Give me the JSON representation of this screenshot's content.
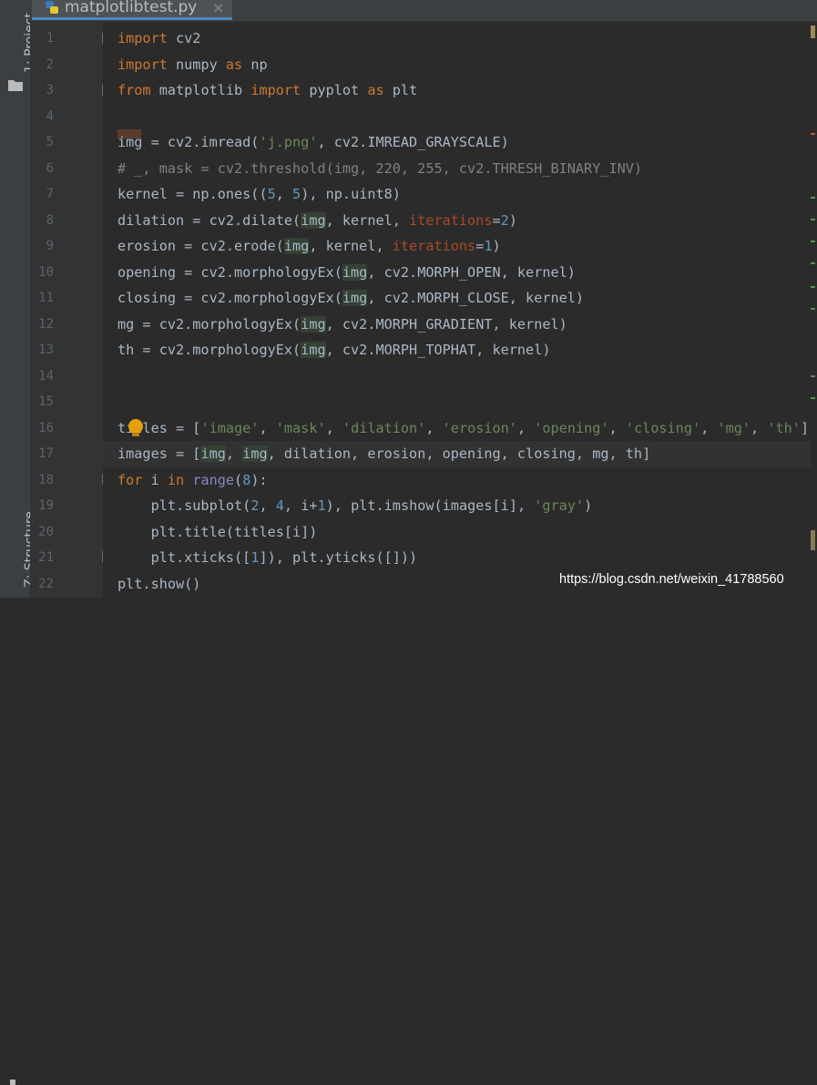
{
  "sidebar": {
    "project_label": "1: Project",
    "structure_label": "Z: Structure"
  },
  "tab": {
    "file_name": "matplotlibtest.py",
    "close_glyph": "×"
  },
  "line_numbers": [
    "1",
    "2",
    "3",
    "4",
    "5",
    "6",
    "7",
    "8",
    "9",
    "10",
    "11",
    "12",
    "13",
    "14",
    "15",
    "16",
    "17",
    "18",
    "19",
    "20",
    "21",
    "22"
  ],
  "code": {
    "l1": {
      "kw": "import",
      "rest": " cv2"
    },
    "l2": {
      "kw1": "import",
      "mid": " numpy ",
      "kw2": "as",
      "rest": " np"
    },
    "l3": {
      "kw1": "from",
      "mid1": " matplotlib ",
      "kw2": "import",
      "mid2": " pyplot ",
      "kw3": "as",
      "rest": " plt"
    },
    "l5": {
      "a": "img = cv2.imread(",
      "s1": "'j.png'",
      "b": ", cv2.IMREAD_GRAYSCALE)"
    },
    "l6": {
      "comment": "# _, mask = cv2.threshold(img, 220, 255, cv2.THRESH_BINARY_INV)"
    },
    "l7": {
      "a": "kernel = np.ones((",
      "n1": "5",
      "b": ", ",
      "n2": "5",
      "c": "), np.uint8)"
    },
    "l8": {
      "a": "dilation = cv2.dilate(",
      "img": "img",
      "b": ", kernel, ",
      "kwarg": "iterations",
      "c": "=",
      "n": "2",
      "d": ")"
    },
    "l9": {
      "a": "erosion = cv2.erode(",
      "img": "img",
      "b": ", kernel, ",
      "kwarg": "iterations",
      "c": "=",
      "n": "1",
      "d": ")"
    },
    "l10": {
      "a": "opening = cv2.morphologyEx(",
      "img": "img",
      "b": ", cv2.MORPH_OPEN, kernel)"
    },
    "l11": {
      "a": "closing = cv2.morphologyEx(",
      "img": "img",
      "b": ", cv2.MORPH_CLOSE, kernel)"
    },
    "l12": {
      "a": "mg = cv2.morphologyEx(",
      "img": "img",
      "b": ", cv2.MORPH_GRADIENT, kernel)"
    },
    "l13": {
      "a": "th = cv2.morphologyEx(",
      "img": "img",
      "b": ", cv2.MORPH_TOPHAT, kernel)"
    },
    "l16": {
      "a": "titles = [",
      "s1": "'image'",
      "s2": "'mask'",
      "s3": "'dilation'",
      "s4": "'erosion'",
      "s5": "'opening'",
      "s6": "'closing'",
      "s7": "'mg'",
      "s8": "'th'",
      "sep": ", ",
      "end": "]"
    },
    "l17": {
      "a": "images = [",
      "img1": "img",
      "sep": ", ",
      "img2": "img",
      "b": ", dilation, erosion, opening, closing, mg, th]"
    },
    "l18": {
      "kw1": "for",
      "mid": " i ",
      "kw2": "in",
      "sp": " ",
      "bi": "range",
      "a": "(",
      "n": "8",
      "b": "):"
    },
    "l19": {
      "a": "    plt.subplot(",
      "n1": "2",
      "sep": ", ",
      "n2": "4",
      "b": ", i+",
      "n3": "1",
      "c": "), plt.imshow(images[i], ",
      "s": "'gray'",
      "d": ")"
    },
    "l20": {
      "a": "    plt.title(titles[i])"
    },
    "l21": {
      "a": "    plt.xticks([",
      "n": "1",
      "b": "]), plt.yticks([]))"
    },
    "l22": {
      "a": "plt.show()"
    }
  },
  "watermark": "https://blog.csdn.net/weixin_41788560",
  "colors": {
    "background": "#2b2b2b",
    "keyword": "#cc7832",
    "string": "#6a8759",
    "number": "#6897bb",
    "comment": "#808080",
    "text": "#a9b7c6"
  }
}
